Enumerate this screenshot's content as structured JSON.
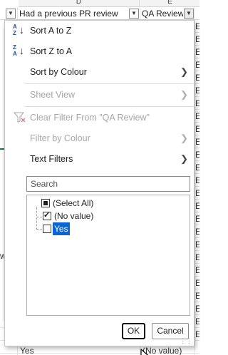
{
  "sheet": {
    "col_d": "D",
    "col_e": "E",
    "header_d": "Had a previous PR review",
    "header_e": "QA Review",
    "col_e_peek": "E",
    "left_peek": "w",
    "bottom_left": "Yes",
    "bottom_right": "(No value)"
  },
  "menu": {
    "sort_az": "Sort A to Z",
    "sort_za": "Sort Z to A",
    "sort_by_colour": "Sort by Colour",
    "sheet_view": "Sheet View",
    "clear_filter": "Clear Filter From \"QA Review\"",
    "filter_by_colour": "Filter by Colour",
    "text_filters": "Text Filters"
  },
  "search": {
    "placeholder": "Search"
  },
  "list": {
    "items": [
      {
        "label": "(Select All)",
        "state": "mixed"
      },
      {
        "label": "(No value)",
        "state": "checked"
      },
      {
        "label": "Yes",
        "state": "unchecked"
      }
    ]
  },
  "buttons": {
    "ok": "OK",
    "cancel": "Cancel"
  },
  "colors": {
    "accent": "#0a64d6",
    "icon_blue": "#1e4e9a",
    "excel_green": "#217346",
    "disabled": "#a6a6a6"
  },
  "icons": [
    "sort-ascending-icon",
    "sort-descending-icon",
    "chevron-right-icon",
    "clear-filter-icon",
    "filter-dropdown-icon",
    "mouse-cursor-icon",
    "resize-grip-icon"
  ]
}
